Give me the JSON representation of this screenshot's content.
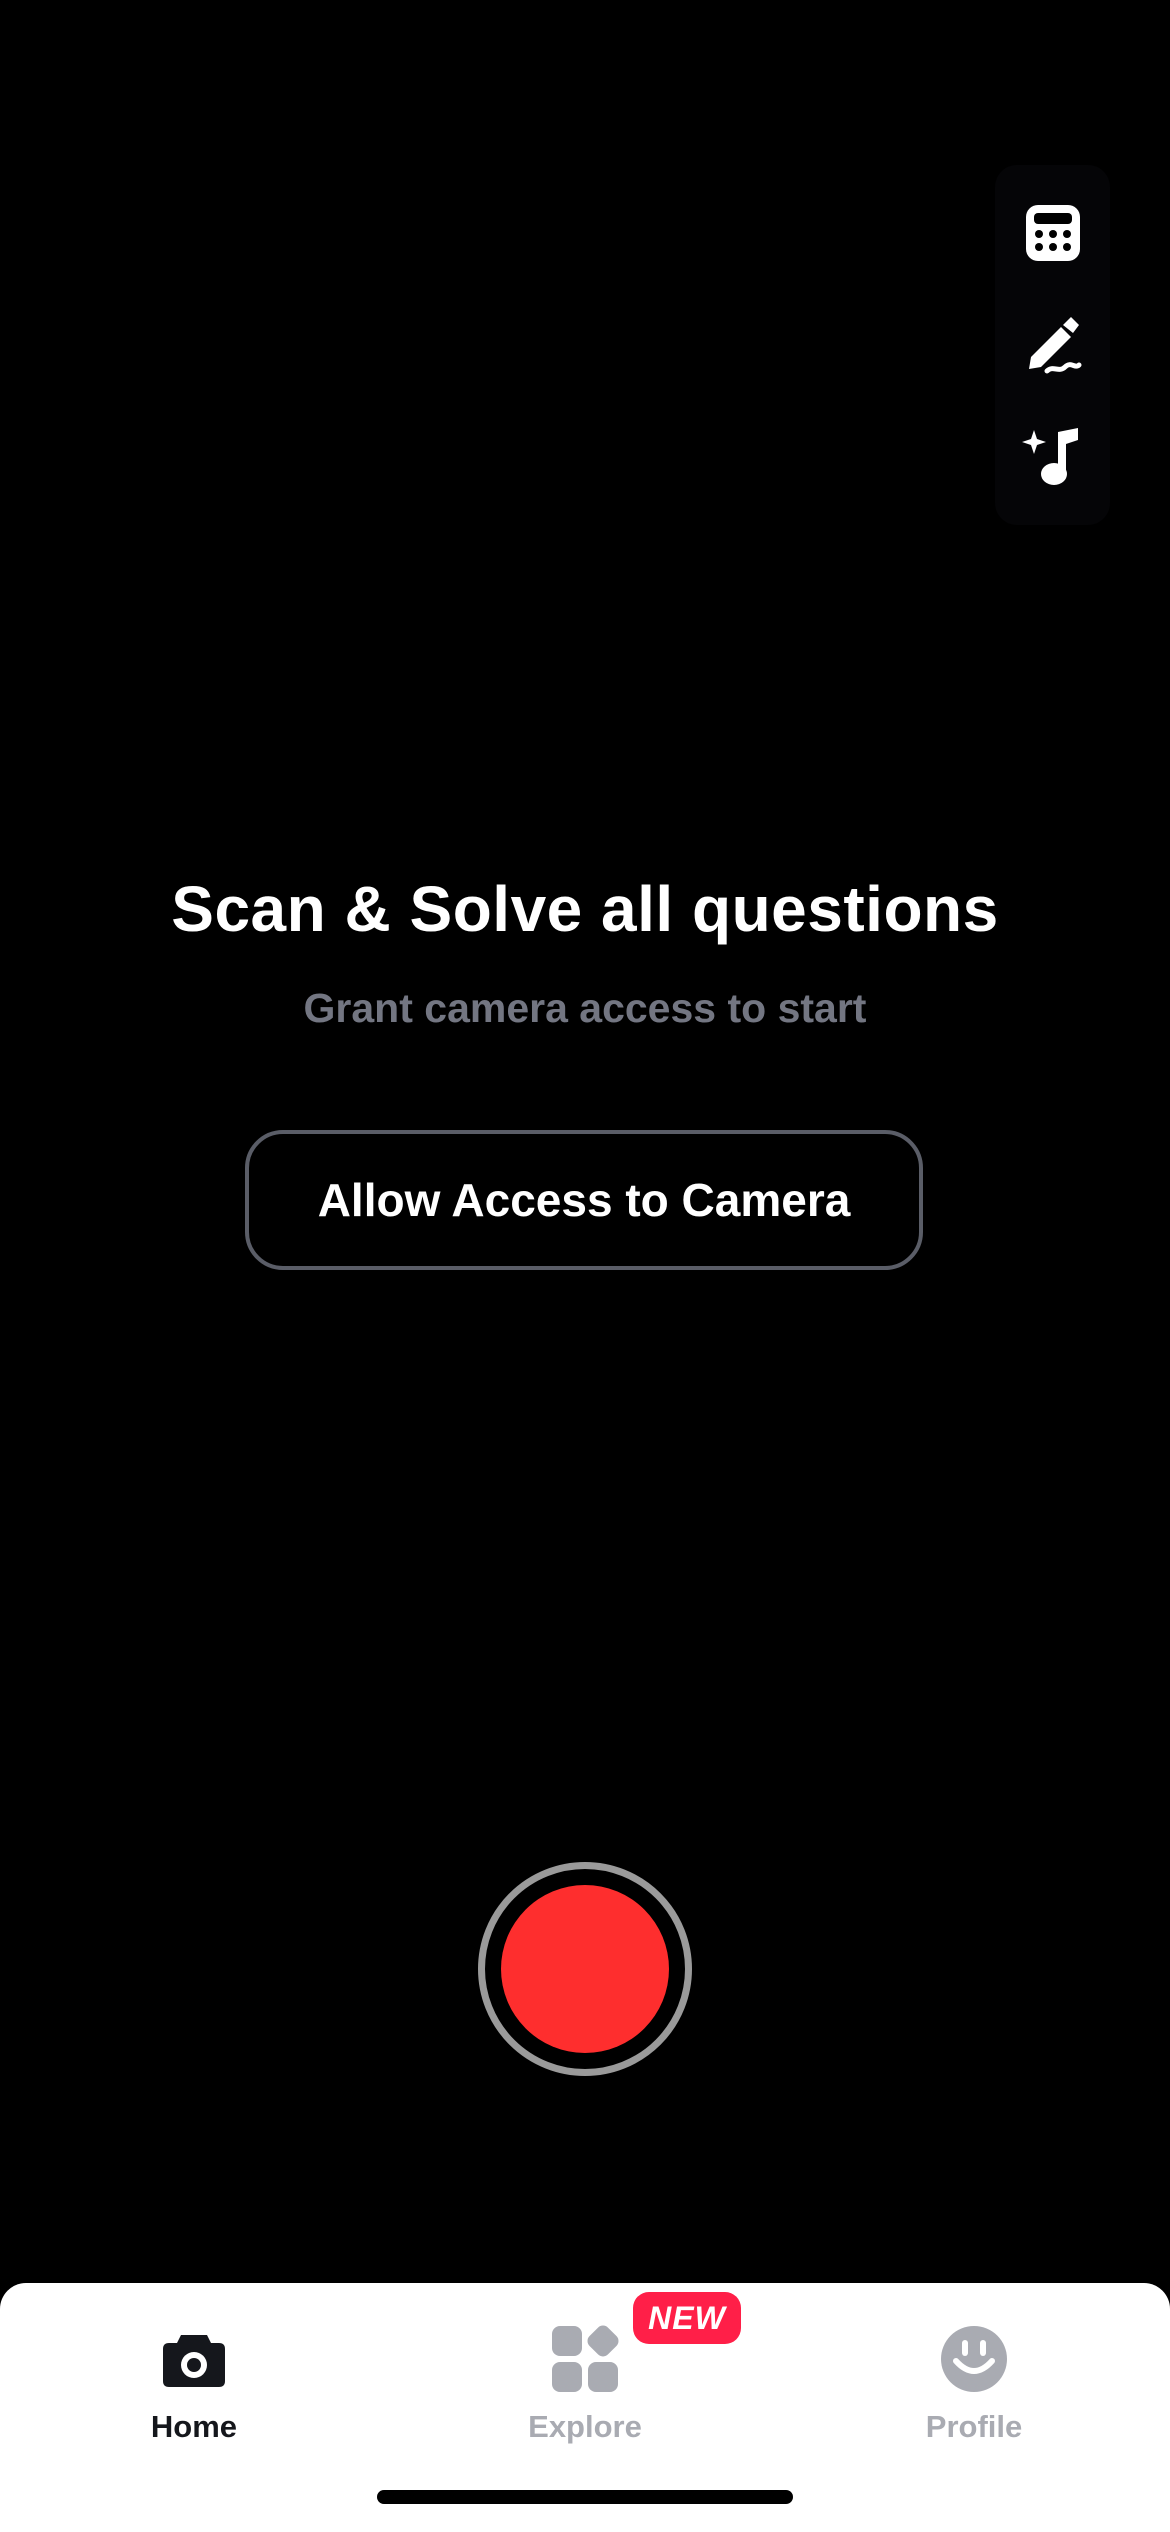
{
  "tools": [
    {
      "name": "calculator",
      "icon": "calculator-icon"
    },
    {
      "name": "writing",
      "icon": "pen-scribble-icon"
    },
    {
      "name": "ai-music",
      "icon": "sparkle-music-note-icon"
    }
  ],
  "main": {
    "headline": "Scan & Solve all questions",
    "subheadline": "Grant camera access to start",
    "allow_button_label": "Allow Access to Camera"
  },
  "shutter": {
    "icon": "shutter-button",
    "color": "#fe2e2e"
  },
  "tabbar": {
    "tabs": [
      {
        "label": "Home",
        "icon": "camera-icon",
        "active": true
      },
      {
        "label": "Explore",
        "icon": "grid-shapes-icon",
        "active": false,
        "badge": "NEW"
      },
      {
        "label": "Profile",
        "icon": "smiley-face-icon",
        "active": false
      }
    ]
  },
  "colors": {
    "background": "#000000",
    "accent_red": "#fe2e2e",
    "badge_red": "#ff1f48",
    "muted_text": "#737682",
    "inactive_tab": "#a9abb2"
  }
}
